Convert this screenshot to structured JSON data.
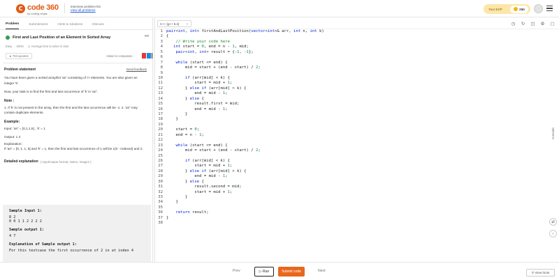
{
  "header": {
    "logo_mark": "C",
    "logo_text": "code 360",
    "logo_sub": "by coding ninjas",
    "interview_line": "Interview problem list",
    "view_all": "View all problems",
    "exp_label": "Your EXP",
    "exp_value": "250"
  },
  "tabs": [
    "Problem",
    "Submissions",
    "Hints & solutions",
    "Discuss"
  ],
  "problem": {
    "title": "First and Last Position of an Element In Sorted Array",
    "difficulty": "Easy",
    "score": "40/40",
    "avg_time": "Average time to solve is 15m",
    "upvotes": "794 upvotes",
    "asked_in": "Asked in companies",
    "statement_heading": "Problem statement",
    "send_feedback": "Send feedback",
    "statement": "You have been given a sorted array/list 'arr' consisting of 'n' elements. You are also given an integer 'k'.",
    "task": "Now, your task is to find the first and last occurrence of 'k' in 'arr'.",
    "note_heading": "Note :",
    "note": "1. If 'k' is not present in the array, then the first and the last occurrence will be -1. 2. 'arr' may contain duplicate elements.",
    "example_heading": "Example:",
    "example_input": "Input: 'arr' = [0,1,1,5] , 'k' = 1",
    "example_output": "Output: 1 2",
    "explanation_heading": "Explanation:",
    "explanation": "If 'arr' = [0, 1, 1, 5] and 'k' = 1, then the first and last occurrence of 1 will be 1(0 - indexed) and 2.",
    "detailed_heading": "Detailed explanation",
    "detailed_sub": "( Input/output format, Notes, Images )"
  },
  "samples": {
    "input_heading": "Sample Input 1:",
    "input_values": "8 2\n0 0 1 1 2 2 2 2",
    "output_heading": "Sample output 1:",
    "output_values": "4 7",
    "expl_heading": "Explanation of Sample output 1:",
    "expl_text": "For this testcase the first occurrence of 2 in at index 4"
  },
  "editor": {
    "language": "C++ (g++ 5.4)",
    "lines": [
      "pair<int, int> firstAndLastPosition(vector<int>& arr, int n, int k)",
      "{",
      "    // Write your code here",
      "   int start = 0, end = n - 1, mid;",
      "    pair<int, int> result = {-1, -1};",
      "",
      "    while (start <= end) {",
      "        mid = start + (end - start) / 2;",
      "",
      "        if (arr[mid] < k) {",
      "            start = mid + 1;",
      "        } else if (arr[mid] > k) {",
      "            end = mid - 1;",
      "        } else {",
      "            result.first = mid;",
      "            end = mid - 1;",
      "        }",
      "    }",
      "",
      "    start = 0;",
      "    end = n - 1;",
      "",
      "    while (start <= end) {",
      "        mid = start + (end - start) / 2;",
      "",
      "        if (arr[mid] < k) {",
      "            start = mid + 1;",
      "        } else if (arr[mid] > k) {",
      "            end = mid - 1;",
      "        } else {",
      "            result.second = mid;",
      "            start = mid + 1;",
      "        }",
      "    }",
      "",
      "    return result;",
      "}",
      ""
    ],
    "console_label": "Console"
  },
  "footer": {
    "prev": "Prev",
    "run": "Run",
    "submit": "Submit code",
    "next": "Next",
    "view_hints": "View hints"
  },
  "colors": {
    "brand": "#e05a14",
    "submit": "#e8671c",
    "keyword": "#0022dd",
    "comment": "#1c8c2a",
    "solved": "#2e9e4f"
  }
}
